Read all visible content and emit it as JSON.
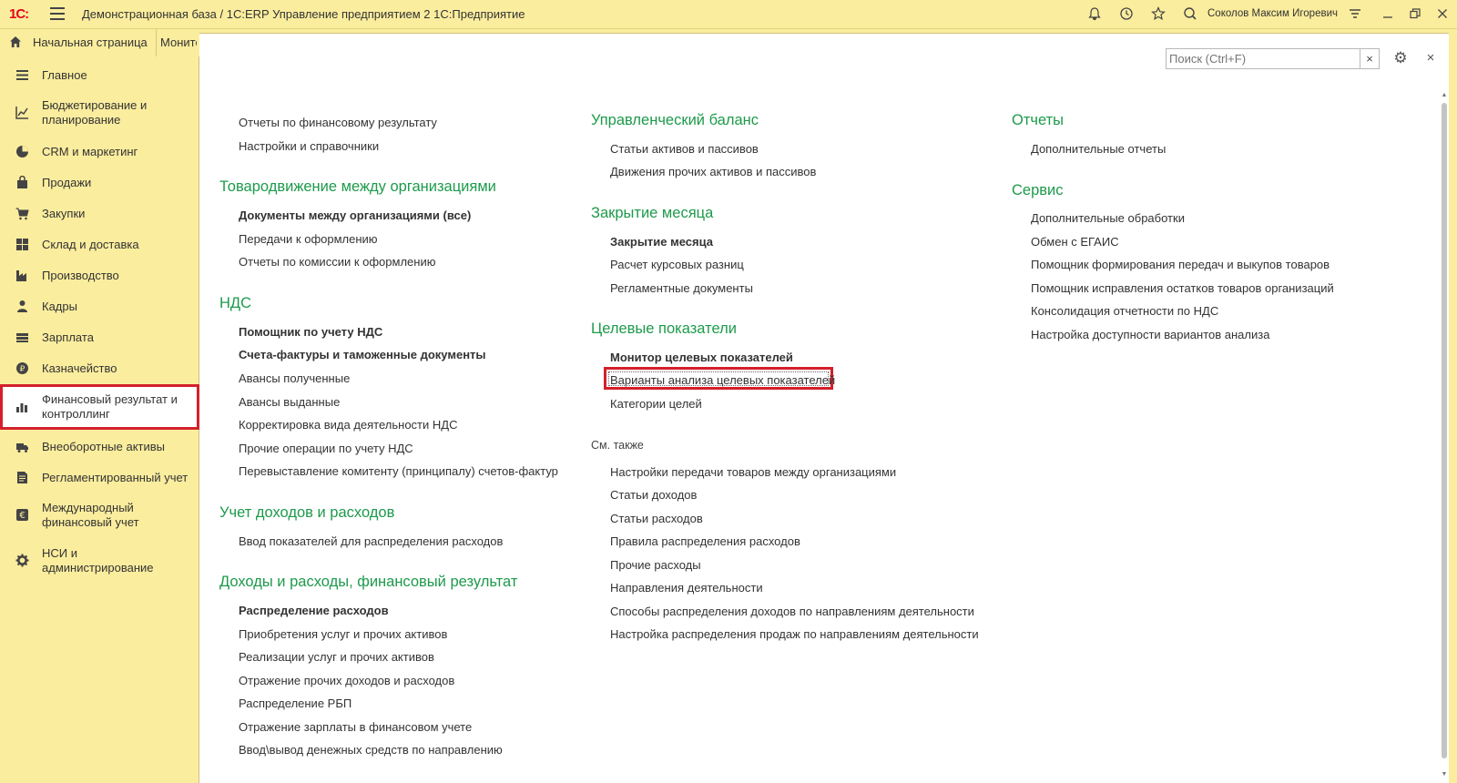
{
  "titlebar": {
    "logo": "1С:",
    "title": "Демонстрационная база / 1С:ERP Управление предприятием 2 1С:Предприятие",
    "user": "Соколов Максим Игоревич"
  },
  "tabs": {
    "home": "Начальная страница",
    "next": "Монито"
  },
  "sidebar": {
    "items": [
      {
        "label": "Главное",
        "icon": "list-icon"
      },
      {
        "label": "Бюджетирование и планирование",
        "icon": "chart-up-icon"
      },
      {
        "label": "CRM и маркетинг",
        "icon": "pie-icon"
      },
      {
        "label": "Продажи",
        "icon": "bag-icon"
      },
      {
        "label": "Закупки",
        "icon": "cart-icon"
      },
      {
        "label": "Склад и доставка",
        "icon": "grid-icon"
      },
      {
        "label": "Производство",
        "icon": "factory-icon"
      },
      {
        "label": "Кадры",
        "icon": "person-icon"
      },
      {
        "label": "Зарплата",
        "icon": "money-icon"
      },
      {
        "label": "Казначейство",
        "icon": "coin-icon"
      },
      {
        "label": "Финансовый результат и контроллинг",
        "icon": "bar-chart-icon"
      },
      {
        "label": "Внеоборотные активы",
        "icon": "truck-icon"
      },
      {
        "label": "Регламентированный учет",
        "icon": "document-icon"
      },
      {
        "label": "Международный финансовый учет",
        "icon": "euro-icon"
      },
      {
        "label": "НСИ и администрирование",
        "icon": "gear-icon"
      }
    ]
  },
  "search": {
    "placeholder": "Поиск (Ctrl+F)",
    "clear": "×"
  },
  "toolbar": {
    "gear": "⚙",
    "close": "×"
  },
  "col1": {
    "top_links": [
      "Отчеты по финансовому результату",
      "Настройки и справочники"
    ],
    "sections": [
      {
        "title": "Товародвижение между организациями",
        "links": [
          {
            "label": "Документы между организациями (все)",
            "bold": true
          },
          {
            "label": "Передачи к оформлению",
            "bold": false
          },
          {
            "label": "Отчеты по комиссии к оформлению",
            "bold": false
          }
        ]
      },
      {
        "title": "НДС",
        "links": [
          {
            "label": "Помощник по учету НДС",
            "bold": true
          },
          {
            "label": "Счета-фактуры и таможенные документы",
            "bold": true
          },
          {
            "label": "Авансы полученные",
            "bold": false
          },
          {
            "label": "Авансы выданные",
            "bold": false
          },
          {
            "label": "Корректировка вида деятельности НДС",
            "bold": false
          },
          {
            "label": "Прочие операции по учету НДС",
            "bold": false
          },
          {
            "label": "Перевыставление комитенту (принципалу) счетов-фактур",
            "bold": false
          }
        ]
      },
      {
        "title": "Учет доходов и расходов",
        "links": [
          {
            "label": "Ввод показателей для распределения расходов",
            "bold": false
          }
        ]
      },
      {
        "title": "Доходы и расходы, финансовый результат",
        "links": [
          {
            "label": "Распределение расходов",
            "bold": true
          },
          {
            "label": "Приобретения услуг и прочих активов",
            "bold": false
          },
          {
            "label": "Реализации услуг и прочих активов",
            "bold": false
          },
          {
            "label": "Отражение прочих доходов и расходов",
            "bold": false
          },
          {
            "label": "Распределение РБП",
            "bold": false
          },
          {
            "label": "Отражение зарплаты в финансовом учете",
            "bold": false
          },
          {
            "label": "Ввод\\вывод денежных средств по направлению",
            "bold": false
          }
        ]
      }
    ]
  },
  "col2": {
    "sections": [
      {
        "title": "Управленческий баланс",
        "links": [
          {
            "label": "Статьи активов и пассивов",
            "bold": false
          },
          {
            "label": "Движения прочих активов и пассивов",
            "bold": false
          }
        ]
      },
      {
        "title": "Закрытие месяца",
        "links": [
          {
            "label": "Закрытие месяца",
            "bold": true
          },
          {
            "label": "Расчет курсовых разниц",
            "bold": false
          },
          {
            "label": "Регламентные документы",
            "bold": false
          }
        ]
      },
      {
        "title": "Целевые показатели",
        "links": [
          {
            "label": "Монитор целевых показателей",
            "bold": true
          },
          {
            "label": "Варианты анализа целевых показателей",
            "bold": false
          },
          {
            "label": "Категории целей",
            "bold": false
          }
        ]
      }
    ],
    "see_also_title": "См. также",
    "see_also": [
      "Настройки передачи товаров между организациями",
      "Статьи доходов",
      "Статьи расходов",
      "Правила распределения расходов",
      "Прочие расходы",
      "Направления деятельности",
      "Способы распределения доходов по направлениям деятельности",
      "Настройка распределения продаж по направлениям деятельности"
    ]
  },
  "col3": {
    "sections": [
      {
        "title": "Отчеты",
        "links": [
          {
            "label": "Дополнительные отчеты",
            "bold": false
          }
        ]
      },
      {
        "title": "Сервис",
        "links": [
          {
            "label": "Дополнительные обработки",
            "bold": false
          },
          {
            "label": "Обмен с ЕГАИС",
            "bold": false
          },
          {
            "label": "Помощник формирования передач и выкупов товаров",
            "bold": false
          },
          {
            "label": "Помощник исправления остатков товаров организаций",
            "bold": false
          },
          {
            "label": "Консолидация отчетности по НДС",
            "bold": false
          },
          {
            "label": "Настройка доступности вариантов анализа",
            "bold": false
          }
        ]
      }
    ]
  },
  "colors": {
    "accent_green": "#1d9a4b",
    "panel_yellow": "#fbed9e",
    "highlight_red": "#d4202b"
  }
}
